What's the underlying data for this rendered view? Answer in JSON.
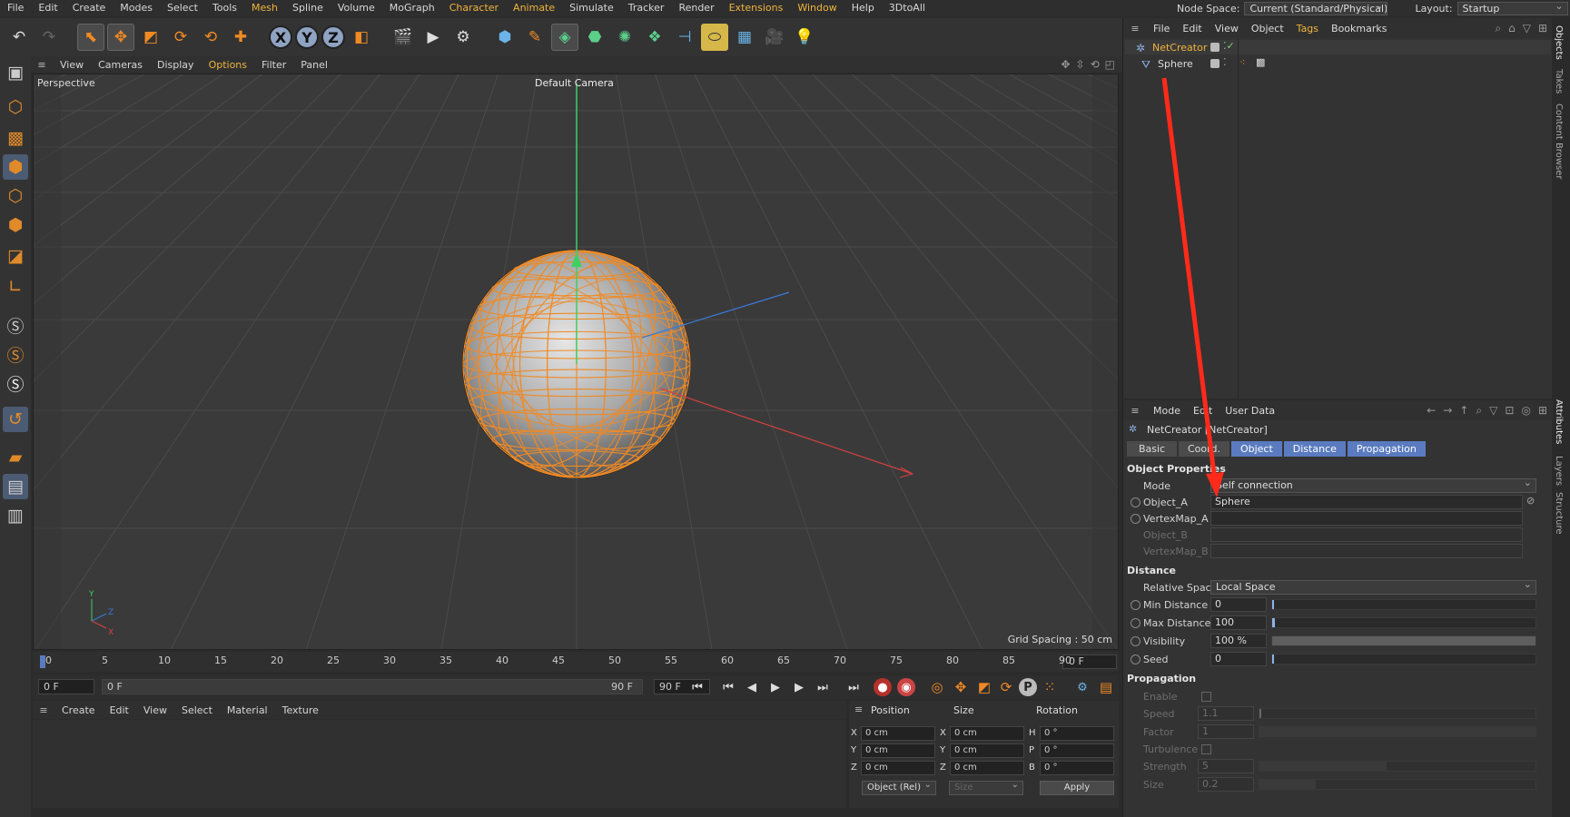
{
  "menubar": {
    "items": [
      "File",
      "Edit",
      "Create",
      "Modes",
      "Select",
      "Tools",
      "Mesh",
      "Spline",
      "Volume",
      "MoGraph",
      "Character",
      "Animate",
      "Simulate",
      "Tracker",
      "Render",
      "Extensions",
      "Window",
      "Help",
      "3DtoAll"
    ],
    "highlighted": [
      "Mesh",
      "Character",
      "Animate",
      "Extensions",
      "Window"
    ],
    "node_space_label": "Node Space:",
    "node_space_value": "Current (Standard/Physical)",
    "layout_label": "Layout:",
    "layout_value": "Startup"
  },
  "viewport_menu": {
    "items": [
      "View",
      "Cameras",
      "Display",
      "Options",
      "Filter",
      "Panel"
    ]
  },
  "viewport": {
    "label": "Perspective",
    "camera": "Default Camera",
    "grid_spacing": "Grid Spacing : 50 cm",
    "axis_y": "Y",
    "axis_z": "Z",
    "axis_x": "X"
  },
  "timeline": {
    "ticks": [
      "0",
      "5",
      "10",
      "15",
      "20",
      "25",
      "30",
      "35",
      "40",
      "45",
      "50",
      "55",
      "60",
      "65",
      "70",
      "75",
      "80",
      "85",
      "90"
    ],
    "current_frame": "0 F"
  },
  "playback": {
    "start": "0 F",
    "range_start": "0 F",
    "range_end": "90 F",
    "end": "90 F"
  },
  "material_menu": {
    "items": [
      "Create",
      "Edit",
      "View",
      "Select",
      "Material",
      "Texture"
    ]
  },
  "coords": {
    "headers": [
      "Position",
      "Size",
      "Rotation"
    ],
    "rows": [
      {
        "axis": "X",
        "pos": "0 cm",
        "size_axis": "X",
        "size": "0 cm",
        "rot_axis": "H",
        "rot": "0 °"
      },
      {
        "axis": "Y",
        "pos": "0 cm",
        "size_axis": "Y",
        "size": "0 cm",
        "rot_axis": "P",
        "rot": "0 °"
      },
      {
        "axis": "Z",
        "pos": "0 cm",
        "size_axis": "Z",
        "size": "0 cm",
        "rot_axis": "B",
        "rot": "0 °"
      }
    ],
    "mode": "Object (Rel)",
    "size_mode": "Size",
    "apply": "Apply"
  },
  "objects_menu": {
    "items": [
      "File",
      "Edit",
      "View",
      "Object",
      "Tags",
      "Bookmarks"
    ]
  },
  "objects": [
    {
      "name": "NetCreator",
      "selected": true
    },
    {
      "name": "Sphere",
      "selected": false
    }
  ],
  "side_tabs": [
    "Objects",
    "Takes",
    "Content Browser",
    "Attributes",
    "Layers",
    "Structure"
  ],
  "attributes": {
    "menu": [
      "Mode",
      "Edit",
      "User Data"
    ],
    "title": "NetCreator [NetCreator]",
    "tabs": [
      "Basic",
      "Coord.",
      "Object",
      "Distance",
      "Propagation"
    ],
    "active_tabs": [
      "Object",
      "Distance",
      "Propagation"
    ],
    "object_section": "Object Properties",
    "mode_label": "Mode",
    "mode_value": "Self connection",
    "object_a_label": "Object_A",
    "object_a_value": "Sphere",
    "vertexmap_a_label": "VertexMap_A",
    "object_b_label": "Object_B",
    "vertexmap_b_label": "VertexMap_B",
    "distance_section": "Distance",
    "relative_space_label": "Relative Space",
    "relative_space_value": "Local Space",
    "min_distance_label": "Min Distance",
    "min_distance_value": "0",
    "max_distance_label": "Max Distance",
    "max_distance_value": "100",
    "visibility_label": "Visibility",
    "visibility_value": "100 %",
    "seed_label": "Seed",
    "seed_value": "0",
    "propagation_section": "Propagation",
    "enable_label": "Enable",
    "speed_label": "Speed",
    "speed_value": "1.1",
    "factor_label": "Factor",
    "factor_value": "1",
    "turbulence_label": "Turbulence",
    "strength_label": "Strength",
    "strength_value": "5",
    "size_label": "Size",
    "size_value": "0.2"
  },
  "colors": {
    "accent_orange": "#f0b43c",
    "tab_active": "#5a7bbf",
    "annotation_arrow": "#ff2a1a",
    "mesh_edge": "#f08a24"
  }
}
